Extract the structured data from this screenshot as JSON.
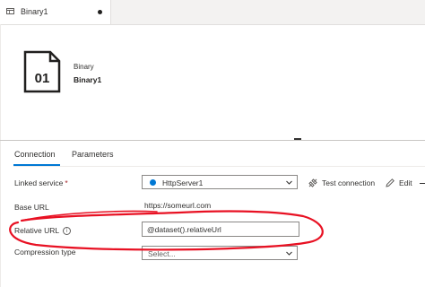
{
  "tab": {
    "label": "Binary1",
    "icon": "dataset-table-icon",
    "unsaved_indicator": "dot"
  },
  "header": {
    "type_label": "Binary",
    "name": "Binary1",
    "icon_text": "01",
    "icon": "binary-file-icon"
  },
  "tabs": [
    {
      "label": "Connection",
      "selected": true
    },
    {
      "label": "Parameters",
      "selected": false
    }
  ],
  "form": {
    "linked_service": {
      "label": "Linked service",
      "required_mark": "*",
      "value": "HttpServer1",
      "icon": "http-server-icon"
    },
    "actions": {
      "test_connection": "Test connection",
      "edit": "Edit"
    },
    "base_url": {
      "label": "Base URL",
      "value": "https://someurl.com"
    },
    "relative_url": {
      "label": "Relative URL",
      "info_icon": "info-icon",
      "value": "@dataset().relativeUrl"
    },
    "compression_type": {
      "label": "Compression type",
      "placeholder": "Select..."
    }
  },
  "colors": {
    "accent": "#0078d4",
    "annotation": "#e81123",
    "required": "#a4262c"
  }
}
